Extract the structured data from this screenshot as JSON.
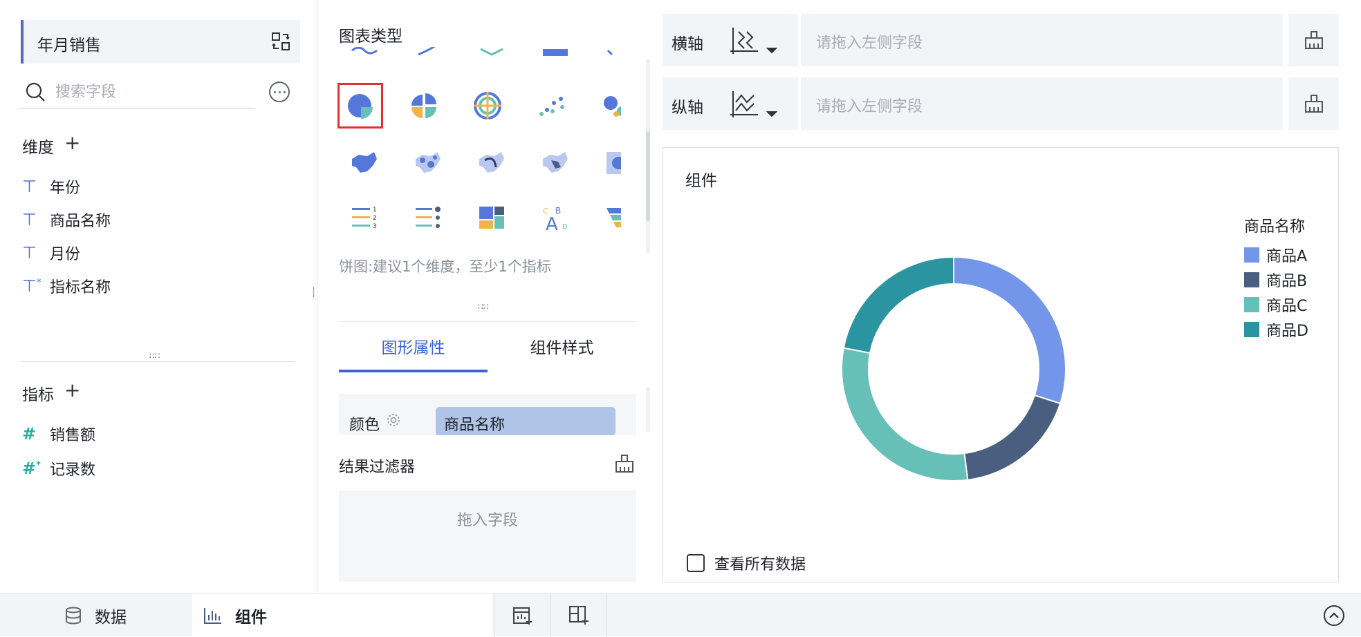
{
  "left_panel": {
    "dataset_title": "年月销售",
    "search_placeholder": "搜索字段",
    "dimensions_title": "维度",
    "dimensions": [
      {
        "label": "年份",
        "icon": "text-field-icon"
      },
      {
        "label": "商品名称",
        "icon": "text-field-icon"
      },
      {
        "label": "月份",
        "icon": "text-field-icon"
      },
      {
        "label": "指标名称",
        "icon": "text-calc-field-icon"
      }
    ],
    "measures_title": "指标",
    "measures": [
      {
        "label": "销售额",
        "icon": "number-field-icon"
      },
      {
        "label": "记录数",
        "icon": "number-calc-field-icon"
      }
    ],
    "add_symbol": "+"
  },
  "chart_panel": {
    "title": "图表类型",
    "hint": "饼图:建议1个维度，至少1个指标",
    "selected_type": "pie",
    "tabs": [
      "图形属性",
      "组件样式"
    ],
    "active_tab": 0,
    "color_label": "颜色",
    "color_field": "商品名称",
    "result_filter_title": "结果过滤器",
    "drop_placeholder": "拖入字段"
  },
  "axes": {
    "x_label": "横轴",
    "y_label": "纵轴",
    "placeholder": "请拖入左侧字段"
  },
  "preview": {
    "title": "组件",
    "legend_title": "商品名称",
    "view_all_label": "查看所有数据",
    "view_all_checked": false
  },
  "chart_data": {
    "type": "pie",
    "variant": "donut",
    "legend_title": "商品名称",
    "legend_position": "top-right",
    "categories": [
      "商品A",
      "商品B",
      "商品C",
      "商品D"
    ],
    "values": [
      30,
      18,
      30,
      22
    ],
    "value_note": "relative shares estimated from slice angles",
    "colors": [
      "#7395ea",
      "#4a5e80",
      "#66c0b7",
      "#2a94a0"
    ]
  },
  "bottom_bar": {
    "tabs": [
      {
        "label": "数据",
        "icon": "database-icon"
      },
      {
        "label": "组件",
        "icon": "bar-chart-icon"
      }
    ],
    "active_tab": 1
  },
  "colors": {
    "accent": "#3a63d6",
    "selected_border": "#e03030",
    "panel_bg": "#f2f4f7",
    "measure_icon": "#25b0a0",
    "dimension_icon": "#4b6fd8"
  }
}
